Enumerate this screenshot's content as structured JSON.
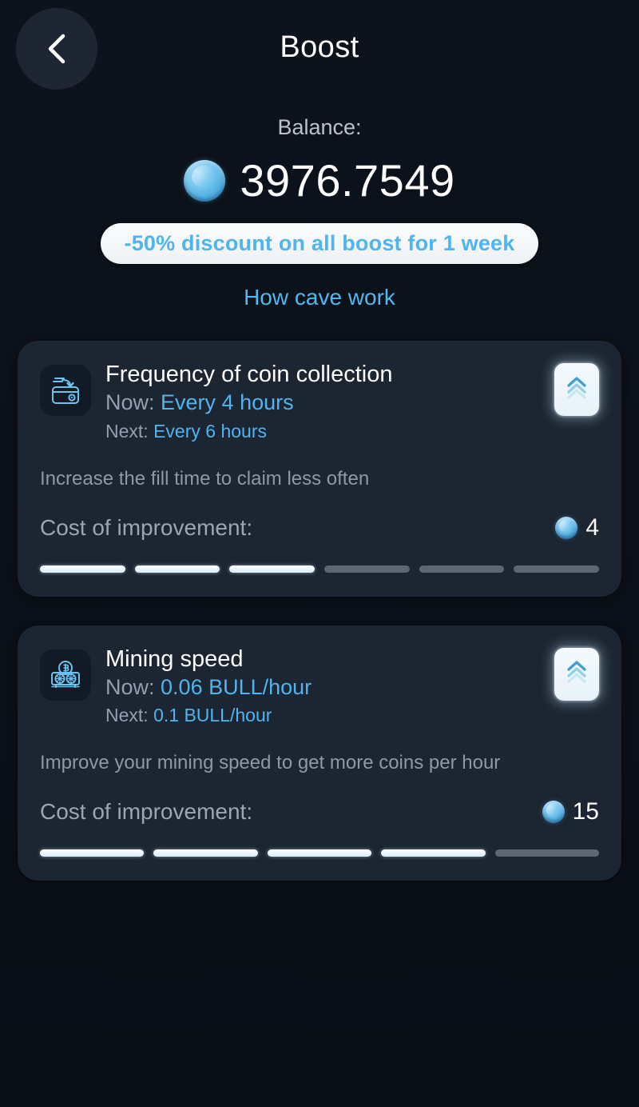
{
  "header": {
    "title": "Boost",
    "back_icon": "chevron-left-icon"
  },
  "balance": {
    "label": "Balance:",
    "value": "3976.7549",
    "coin_icon": "coin-icon"
  },
  "promo": {
    "discount_text": "-50% discount on all boost for 1 week",
    "how_link": "How cave work"
  },
  "colors": {
    "page_bg": "#0b1018",
    "card_bg": "#1c2532",
    "accent_blue": "#4fb4ef",
    "muted_text": "#93a0b1",
    "white": "#ffffff",
    "seg_empty": "#5c6674"
  },
  "cards": [
    {
      "icon": "wallet-deposit-icon",
      "title": "Frequency of coin collection",
      "now_label": "Now:",
      "now_value": "Every 4 hours",
      "next_label": "Next:",
      "next_value": "Every 6 hours",
      "description": "Increase the fill time to claim less often",
      "cost_label": "Cost of improvement:",
      "cost_amount": "4",
      "upgrade_icon": "double-chevron-up-icon",
      "segments_total": 6,
      "segments_filled": 3
    },
    {
      "icon": "gpu-mining-icon",
      "title": "Mining speed",
      "now_label": "Now:",
      "now_value": "0.06 BULL/hour",
      "next_label": "Next:",
      "next_value": "0.1 BULL/hour",
      "description": "Improve your mining speed to get more coins per hour",
      "cost_label": "Cost of improvement:",
      "cost_amount": "15",
      "upgrade_icon": "double-chevron-up-icon",
      "segments_total": 5,
      "segments_filled": 4
    }
  ]
}
